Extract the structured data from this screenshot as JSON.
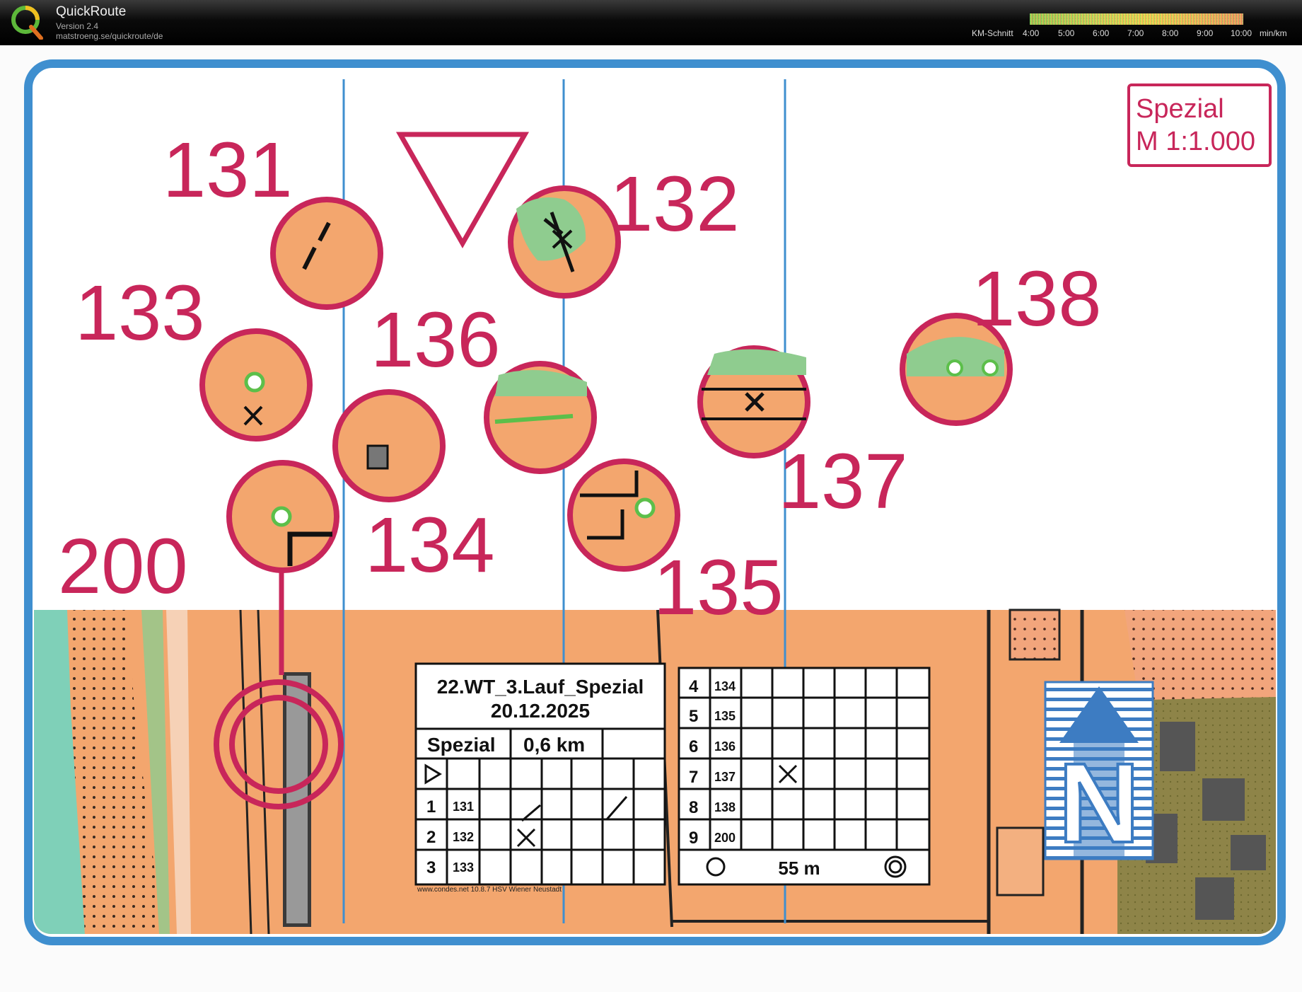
{
  "app": {
    "name": "QuickRoute",
    "version": "Version 2.4",
    "url": "matstroeng.se/quickroute/de"
  },
  "pace_legend": {
    "label": "KM-Schnitt",
    "ticks": [
      "4:00",
      "5:00",
      "6:00",
      "7:00",
      "8:00",
      "9:00",
      "10:00"
    ],
    "unit": "min/km",
    "colors": [
      "#5cbf4a",
      "#b7d95a",
      "#f5e04a",
      "#f7a25a",
      "#f06a6a"
    ]
  },
  "map": {
    "scale_box": {
      "line1": "Spezial",
      "line2": "M 1:1.000"
    },
    "controls": [
      {
        "number": "131"
      },
      {
        "number": "132"
      },
      {
        "number": "133"
      },
      {
        "number": "134"
      },
      {
        "number": "135"
      },
      {
        "number": "136"
      },
      {
        "number": "137"
      },
      {
        "number": "138"
      },
      {
        "number": "200"
      }
    ],
    "north_label": "N",
    "colors": {
      "overprint": "#c8265a",
      "terrain": "#f3a66e",
      "frame": "#3f8fcf",
      "vegetation": "#8fcc8f"
    }
  },
  "control_descriptions": {
    "title": "22.WT_3.Lauf_Spezial",
    "date": "20.12.2025",
    "class": "Spezial",
    "length": "0,6 km",
    "rows_left": [
      {
        "seq": "1",
        "code": "131"
      },
      {
        "seq": "2",
        "code": "132"
      },
      {
        "seq": "3",
        "code": "133"
      }
    ],
    "rows_right": [
      {
        "seq": "4",
        "code": "134"
      },
      {
        "seq": "5",
        "code": "135"
      },
      {
        "seq": "6",
        "code": "136"
      },
      {
        "seq": "7",
        "code": "137"
      },
      {
        "seq": "8",
        "code": "138"
      },
      {
        "seq": "9",
        "code": "200"
      }
    ],
    "finish_distance": "55 m",
    "footer": "www.condes.net 10.8.7 HSV Wiener Neustadt"
  }
}
